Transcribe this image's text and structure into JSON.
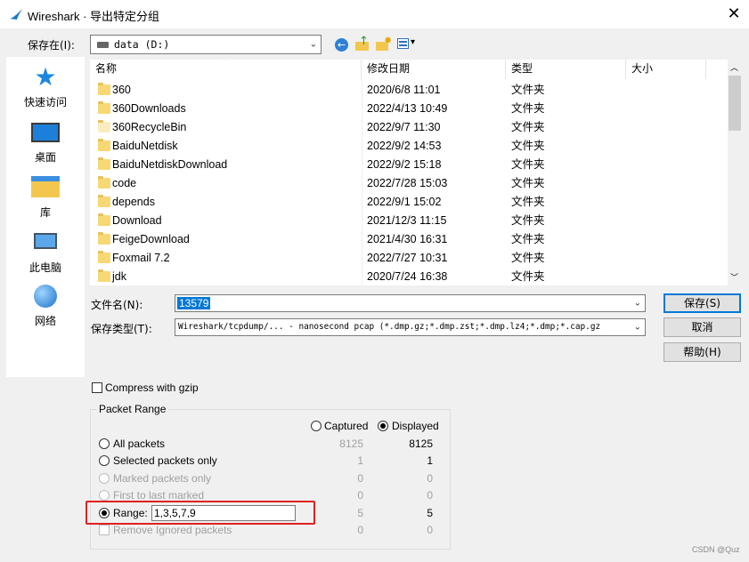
{
  "window": {
    "title": "Wireshark · 导出特定分组"
  },
  "savein": {
    "label": "保存在(I):",
    "value": "data (D:)"
  },
  "sidebar": {
    "items": [
      {
        "label": "快速访问"
      },
      {
        "label": "桌面"
      },
      {
        "label": "库"
      },
      {
        "label": "此电脑"
      },
      {
        "label": "网络"
      }
    ]
  },
  "filelist": {
    "headers": [
      "名称",
      "修改日期",
      "类型",
      "大小"
    ],
    "rows": [
      {
        "name": "360",
        "date": "2020/6/8 11:01",
        "type": "文件夹"
      },
      {
        "name": "360Downloads",
        "date": "2022/4/13 10:49",
        "type": "文件夹"
      },
      {
        "name": "360RecycleBin",
        "date": "2022/9/7 11:30",
        "type": "文件夹"
      },
      {
        "name": "BaiduNetdisk",
        "date": "2022/9/2 14:53",
        "type": "文件夹"
      },
      {
        "name": "BaiduNetdiskDownload",
        "date": "2022/9/2 15:18",
        "type": "文件夹"
      },
      {
        "name": "code",
        "date": "2022/7/28 15:03",
        "type": "文件夹"
      },
      {
        "name": "depends",
        "date": "2022/9/1 15:02",
        "type": "文件夹"
      },
      {
        "name": "Download",
        "date": "2021/12/3 11:15",
        "type": "文件夹"
      },
      {
        "name": "FeigeDownload",
        "date": "2021/4/30 16:31",
        "type": "文件夹"
      },
      {
        "name": "Foxmail 7.2",
        "date": "2022/7/27 10:31",
        "type": "文件夹"
      },
      {
        "name": "jdk",
        "date": "2020/7/24 16:38",
        "type": "文件夹"
      }
    ]
  },
  "filename": {
    "label": "文件名(N):",
    "value": "13579"
  },
  "filetype": {
    "label": "保存类型(T):",
    "value": "Wireshark/tcpdump/... - nanosecond pcap (*.dmp.gz;*.dmp.zst;*.dmp.lz4;*.dmp;*.cap.gz"
  },
  "buttons": {
    "save": "保存(S)",
    "cancel": "取消",
    "help": "帮助(H)"
  },
  "compress": {
    "label": "Compress with gzip",
    "checked": false
  },
  "range": {
    "title": "Packet Range",
    "captured_label": "Captured",
    "displayed_label": "Displayed",
    "rows": [
      {
        "label": "All packets",
        "captured": "8125",
        "displayed": "8125",
        "enabled": true,
        "selected": false
      },
      {
        "label": "Selected packets only",
        "captured": "1",
        "displayed": "1",
        "enabled": true,
        "selected": false
      },
      {
        "label": "Marked packets only",
        "captured": "0",
        "displayed": "0",
        "enabled": false,
        "selected": false
      },
      {
        "label": "First to last marked",
        "captured": "0",
        "displayed": "0",
        "enabled": false,
        "selected": false
      },
      {
        "label": "Range:",
        "captured": "5",
        "displayed": "5",
        "enabled": true,
        "selected": true
      },
      {
        "label": "Remove Ignored packets",
        "captured": "0",
        "displayed": "0",
        "enabled": false,
        "selected": false
      }
    ],
    "range_value": "1,3,5,7,9"
  },
  "watermark": "CSDN @Quz",
  "colors": {
    "highlight": "#e02020",
    "selection": "#0078d7"
  }
}
